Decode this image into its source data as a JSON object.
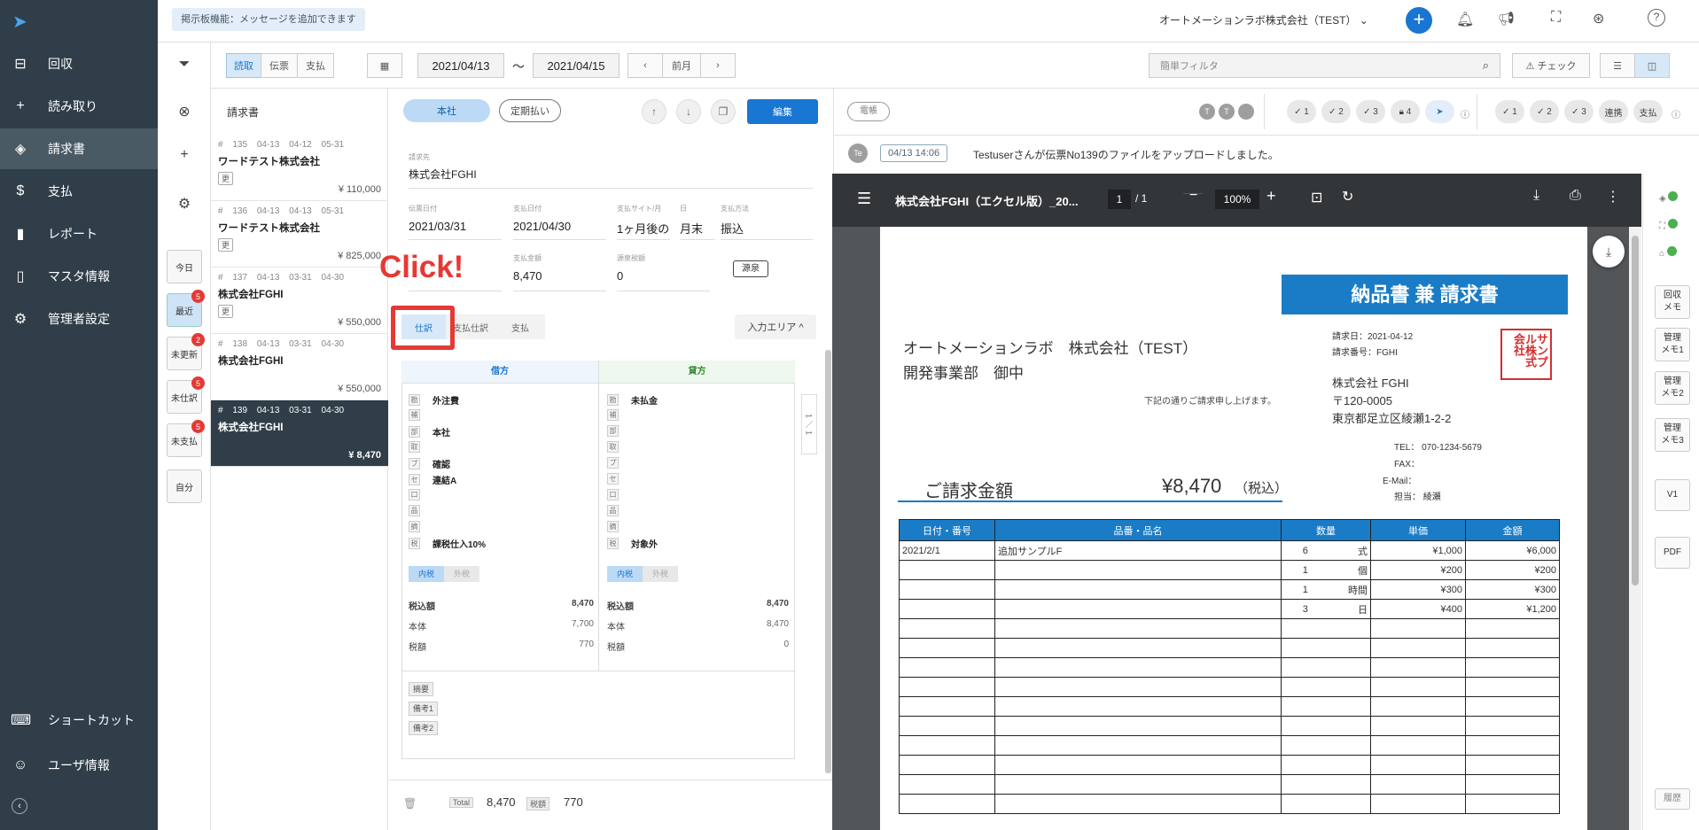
{
  "sidebar": {
    "items": [
      {
        "label": "回収",
        "icon": "inbox-icon"
      },
      {
        "label": "読み取り",
        "icon": "plus-icon"
      },
      {
        "label": "請求書",
        "icon": "layers-icon"
      },
      {
        "label": "支払",
        "icon": "dollar-icon"
      },
      {
        "label": "レポート",
        "icon": "bar-chart-icon"
      },
      {
        "label": "マスタ情報",
        "icon": "book-icon"
      },
      {
        "label": "管理者設定",
        "icon": "gear-icon"
      }
    ],
    "bottom": [
      {
        "label": "ショートカット",
        "icon": "keyboard-icon"
      },
      {
        "label": "ユーザ情報",
        "icon": "user-icon"
      }
    ]
  },
  "topbar": {
    "notice": "掲示板機能：メッセージを追加できます",
    "company": "オートメーションラボ株式会社（TEST）"
  },
  "quick": [
    {
      "label": "今日",
      "badge": ""
    },
    {
      "label": "最近",
      "badge": "5"
    },
    {
      "label": "未更新",
      "badge": "2"
    },
    {
      "label": "未仕訳",
      "badge": "5"
    },
    {
      "label": "未支払",
      "badge": "5"
    },
    {
      "label": "自分",
      "badge": ""
    }
  ],
  "toolbar": {
    "tabs": [
      "読取",
      "伝票",
      "支払"
    ],
    "date_from": "2021/04/13",
    "tilde": "〜",
    "date_to": "2021/04/15",
    "prev_month": "前月",
    "filter_placeholder": "簡単フィルタ",
    "check": "チェック"
  },
  "list": {
    "title": "請求書",
    "items": [
      {
        "no": "# 135",
        "d1": "04-13",
        "d2": "04-12",
        "d3": "05-31",
        "name": "ワードテスト株式会社",
        "tag": "更",
        "amount": "¥ 110,000"
      },
      {
        "no": "# 136",
        "d1": "04-13",
        "d2": "04-13",
        "d3": "05-31",
        "name": "ワードテスト株式会社",
        "tag": "更",
        "amount": "¥ 825,000"
      },
      {
        "no": "# 137",
        "d1": "04-13",
        "d2": "03-31",
        "d3": "04-30",
        "name": "株式会社FGHI",
        "tag": "更",
        "amount": "¥ 550,000"
      },
      {
        "no": "# 138",
        "d1": "04-13",
        "d2": "03-31",
        "d3": "04-30",
        "name": "株式会社FGHI",
        "tag": "",
        "amount": "¥ 550,000"
      },
      {
        "no": "# 139",
        "d1": "04-13",
        "d2": "03-31",
        "d3": "04-30",
        "name": "株式会社FGHI",
        "tag": "",
        "amount": "¥ 8,470"
      }
    ]
  },
  "detail": {
    "pill1": "本社",
    "pill2": "定期払い",
    "edit": "編集",
    "client_label": "請求先",
    "client": "株式会社FGHI",
    "f": [
      {
        "l": "伝票日付",
        "v": "2021/03/31"
      },
      {
        "l": "支払日付",
        "v": "2021/04/30"
      },
      {
        "l": "支払サイト/月",
        "v": "1ヶ月後の"
      },
      {
        "l": "日",
        "v": "月末"
      },
      {
        "l": "支払方法",
        "v": "振込"
      }
    ],
    "f2": [
      {
        "l": "支払金額",
        "v": "8,470"
      },
      {
        "l": "源泉税額",
        "v": "0"
      }
    ],
    "gensen": "源泉",
    "click": "Click!",
    "tabs": [
      "仕訳",
      "支払仕訳",
      "支払"
    ],
    "input_area": "入力エリア ^",
    "debit": "借方",
    "credit": "貸方",
    "drows": [
      {
        "k": "勘",
        "v": "外注費"
      },
      {
        "k": "補",
        "v": ""
      },
      {
        "k": "部",
        "v": "本社"
      },
      {
        "k": "取",
        "v": ""
      },
      {
        "k": "プ",
        "v": "確認"
      },
      {
        "k": "セ",
        "v": "連結A"
      },
      {
        "k": "口",
        "v": ""
      },
      {
        "k": "品",
        "v": ""
      },
      {
        "k": "摘",
        "v": ""
      },
      {
        "k": "税",
        "v": "課税仕入10%"
      }
    ],
    "crows": [
      {
        "k": "勘",
        "v": "未払金"
      },
      {
        "k": "補",
        "v": ""
      },
      {
        "k": "部",
        "v": ""
      },
      {
        "k": "取",
        "v": ""
      },
      {
        "k": "プ",
        "v": ""
      },
      {
        "k": "セ",
        "v": ""
      },
      {
        "k": "口",
        "v": ""
      },
      {
        "k": "品",
        "v": ""
      },
      {
        "k": "摘",
        "v": ""
      },
      {
        "k": "税",
        "v": "対象外"
      }
    ],
    "naizei": "内税",
    "gaizei": "外税",
    "dsum": [
      {
        "l": "税込額",
        "v": "8,470"
      },
      {
        "l": "本体",
        "v": "7,700"
      },
      {
        "l": "税額",
        "v": "770"
      }
    ],
    "csum": [
      {
        "l": "税込額",
        "v": "8,470"
      },
      {
        "l": "本体",
        "v": "8,470"
      },
      {
        "l": "税額",
        "v": "0"
      }
    ],
    "page_ind": "1 ／ 1",
    "memos": [
      "摘要",
      "備考1",
      "備考2"
    ],
    "footer": {
      "total_label": "Total",
      "total": "8,470",
      "tax_label": "税額",
      "tax": "770"
    }
  },
  "right": {
    "denpyo": "電帳",
    "tdots": [
      "T",
      "T",
      ""
    ],
    "checks1": [
      "1",
      "2",
      "3",
      "4"
    ],
    "checks2": [
      "1",
      "2",
      "3"
    ],
    "renkei": "連携",
    "shiharai": "支払",
    "log_avatar": "Te",
    "log_time": "04/13 14:06",
    "log_text": "Testuserさんが伝票No139のファイルをアップロードしました。",
    "pdf": {
      "title": "株式会社FGHI（エクセル版）_20...",
      "page": "1",
      "total": "/ 1",
      "zoom": "100%"
    },
    "sidebtns": [
      "回収\nメモ",
      "管理\nメモ1",
      "管理\nメモ2",
      "管理\nメモ3",
      "V1",
      "PDF"
    ],
    "history": "履歴"
  },
  "doc": {
    "header": "納品書 兼 請求書",
    "date": "請求日：2021-04-12",
    "number": "請求番号：FGHI",
    "to1": "オートメーションラボ　株式会社（TEST）",
    "to2": "開発事業部　御中",
    "note": "下記の通りご請求申し上げます。",
    "from_name": "株式会社 FGHI",
    "from_zip": "〒120-0005",
    "from_addr": "東京都足立区綾瀬1-2-2",
    "tel": "TEL： 070-1234-5679",
    "fax": "FAX：",
    "email": "E-Mail：",
    "tanto": "担当： 綾瀬",
    "seal": "サンプル株式会社",
    "amount_label": "ご請求金額",
    "amount": "¥8,470",
    "amount_note": "（税込）",
    "cols": [
      "日付・番号",
      "品番・品名",
      "数量",
      "単価",
      "金額"
    ],
    "rows": [
      [
        "2021/2/1",
        "追加サンプルF",
        "6",
        "式",
        "¥1,000",
        "¥6,000"
      ],
      [
        "",
        "",
        "1",
        "個",
        "¥200",
        "¥200"
      ],
      [
        "",
        "",
        "1",
        "時間",
        "¥300",
        "¥300"
      ],
      [
        "",
        "",
        "3",
        "日",
        "¥400",
        "¥1,200"
      ]
    ]
  },
  "colors": {
    "sidebar": "#2f3e48",
    "primary": "#1976d2",
    "doc_blue": "#1a7cc6",
    "click_red": "#e53935",
    "seal_red": "#d32f2f"
  }
}
